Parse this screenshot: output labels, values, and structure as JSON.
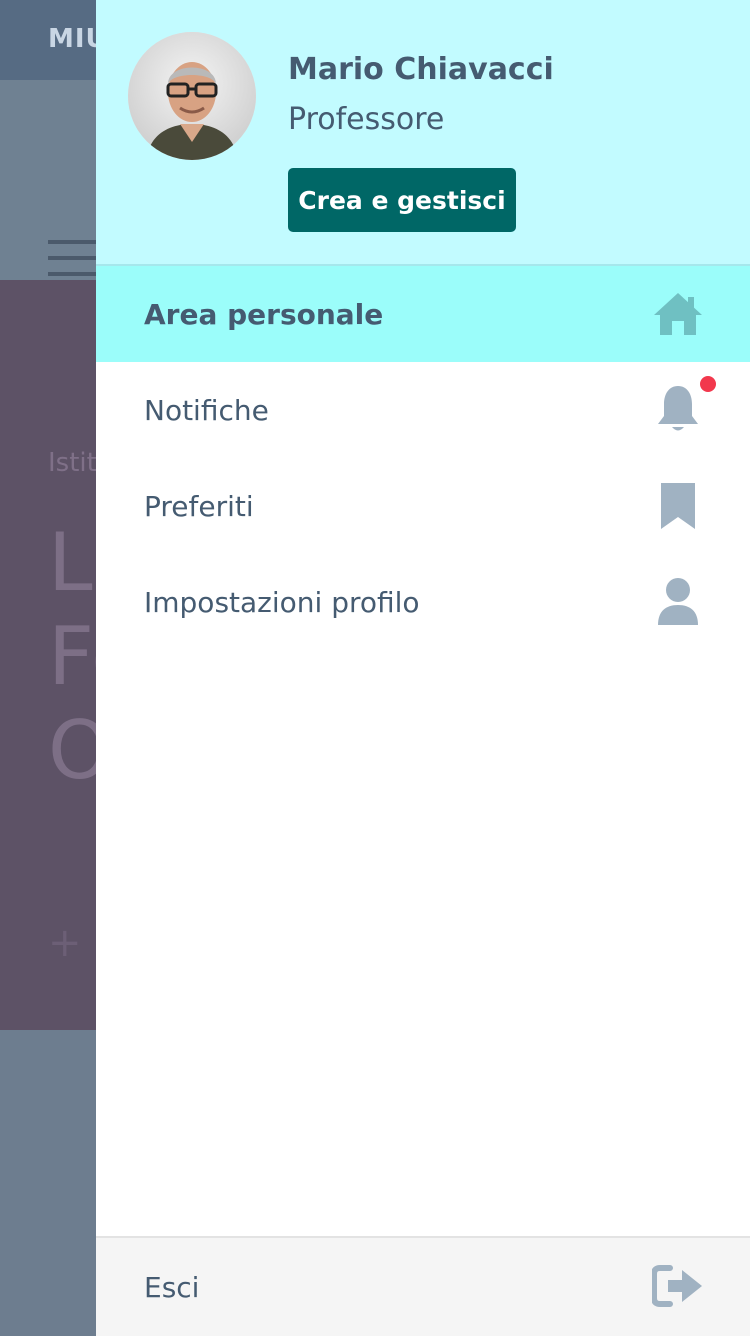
{
  "background": {
    "brand": "MIU",
    "hero_kicker": "Istit",
    "hero_title": "Li\nFo\nO",
    "hero_plus": "+"
  },
  "drawer": {
    "user": {
      "name": "Mario Chiavacci",
      "role": "Professore",
      "action_label": "Crea e gestisci"
    },
    "menu": [
      {
        "label": "Area personale",
        "icon": "home-icon",
        "active": true
      },
      {
        "label": "Notifiche",
        "icon": "bell-icon",
        "active": false,
        "has_unread": true
      },
      {
        "label": "Preferiti",
        "icon": "bookmark-icon",
        "active": false
      },
      {
        "label": "Impostazioni profilo",
        "icon": "user-icon",
        "active": false
      }
    ],
    "footer": {
      "label": "Esci",
      "icon": "logout-icon"
    }
  },
  "colors": {
    "header_bg": "#c2fbff",
    "active_item_bg": "#9bfdfa",
    "button_bg": "#006766",
    "text": "#455b71",
    "icon": "#a0b2c2",
    "active_icon": "#6fc0c2",
    "notification_dot": "#f2384d"
  }
}
